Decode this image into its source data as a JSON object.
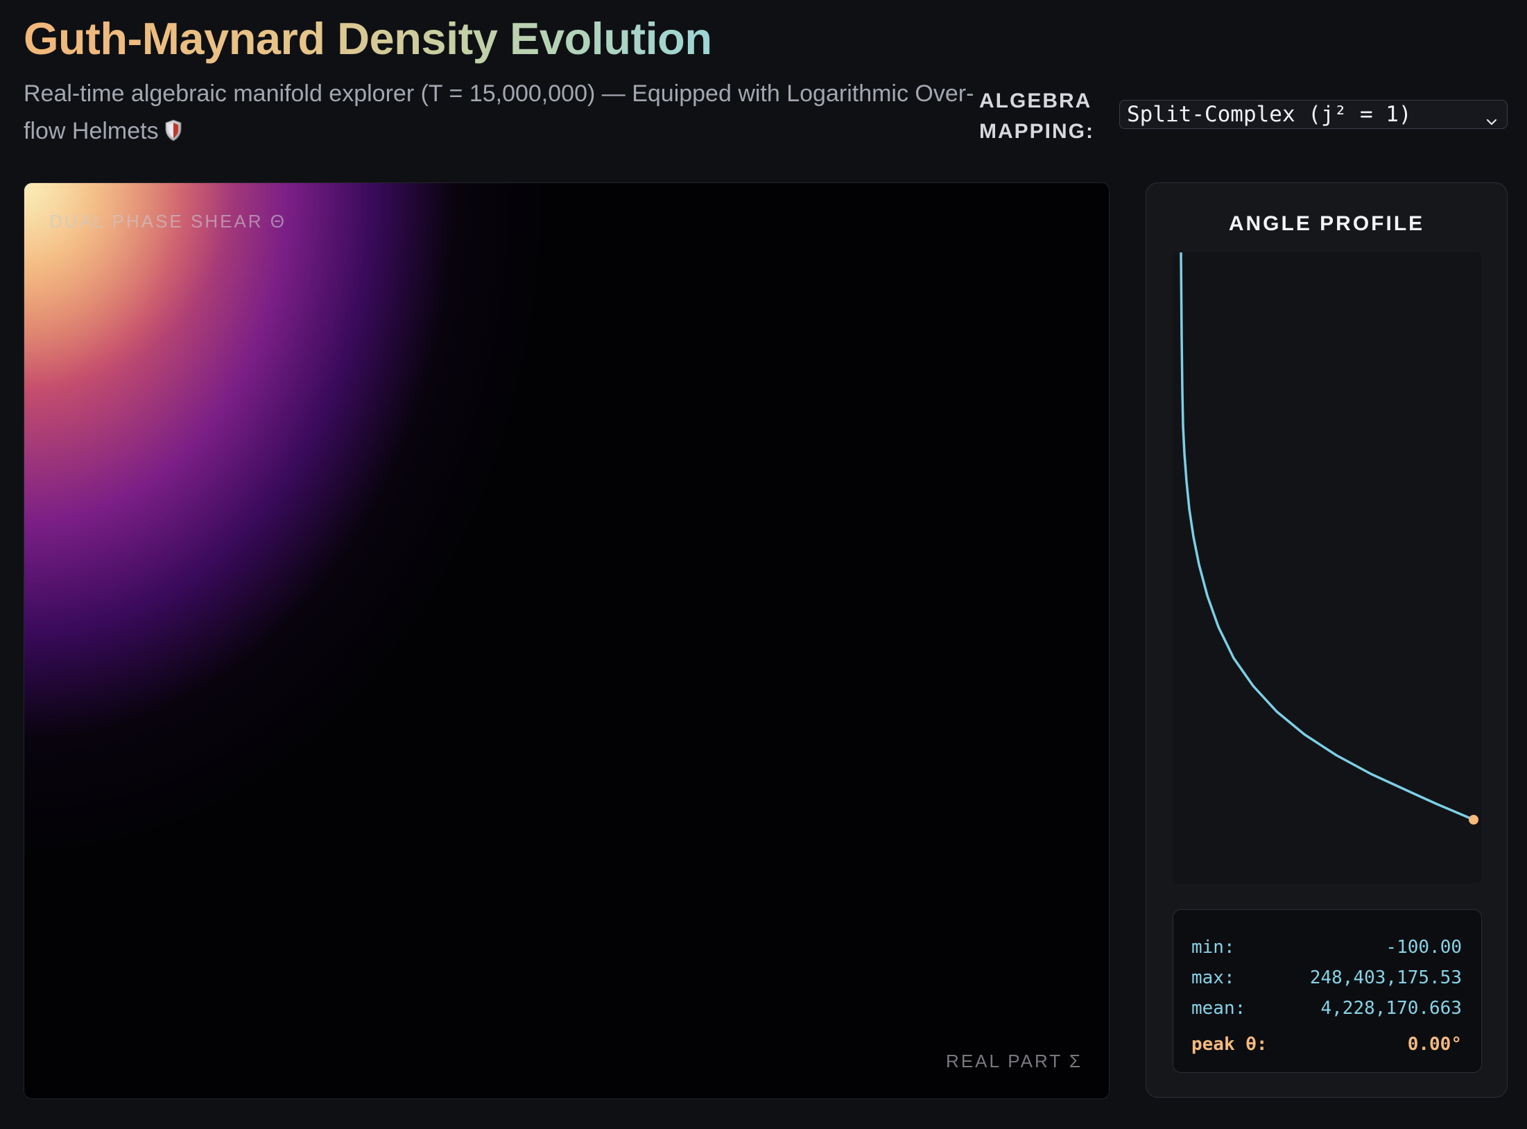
{
  "header": {
    "title": "Guth-Maynard Density Evolution",
    "subtitle": "Real-time algebraic manifold explorer (T = 15,000,000) — Equipped with Logarithmic Over-flow Helmets",
    "subtitle_icon": "shield-icon"
  },
  "controls": {
    "mapping_label": "ALGEBRA MAPPING:",
    "mapping_selected": "Split-Complex (j² = 1)",
    "mapping_icon": "chevron-down-icon"
  },
  "plot": {
    "y_axis_label": "DUAL PHASE SHEAR Θ",
    "x_axis_label": "REAL PART Σ",
    "colormap": [
      "#f8e3a3",
      "#f1a56b",
      "#c64f6d",
      "#7b1f86",
      "#3a0a5c",
      "#020204"
    ]
  },
  "side_panel": {
    "title": "ANGLE PROFILE",
    "line_color": "#7ccfe6",
    "marker_color": "#f4b97c",
    "stats": {
      "min_label": "min:",
      "min_value": "-100.00",
      "max_label": "max:",
      "max_value": "248,403,175.53",
      "mean_label": "mean:",
      "mean_value": "4,228,170.663",
      "peak_label": "peak θ:",
      "peak_value": "0.00°"
    }
  }
}
